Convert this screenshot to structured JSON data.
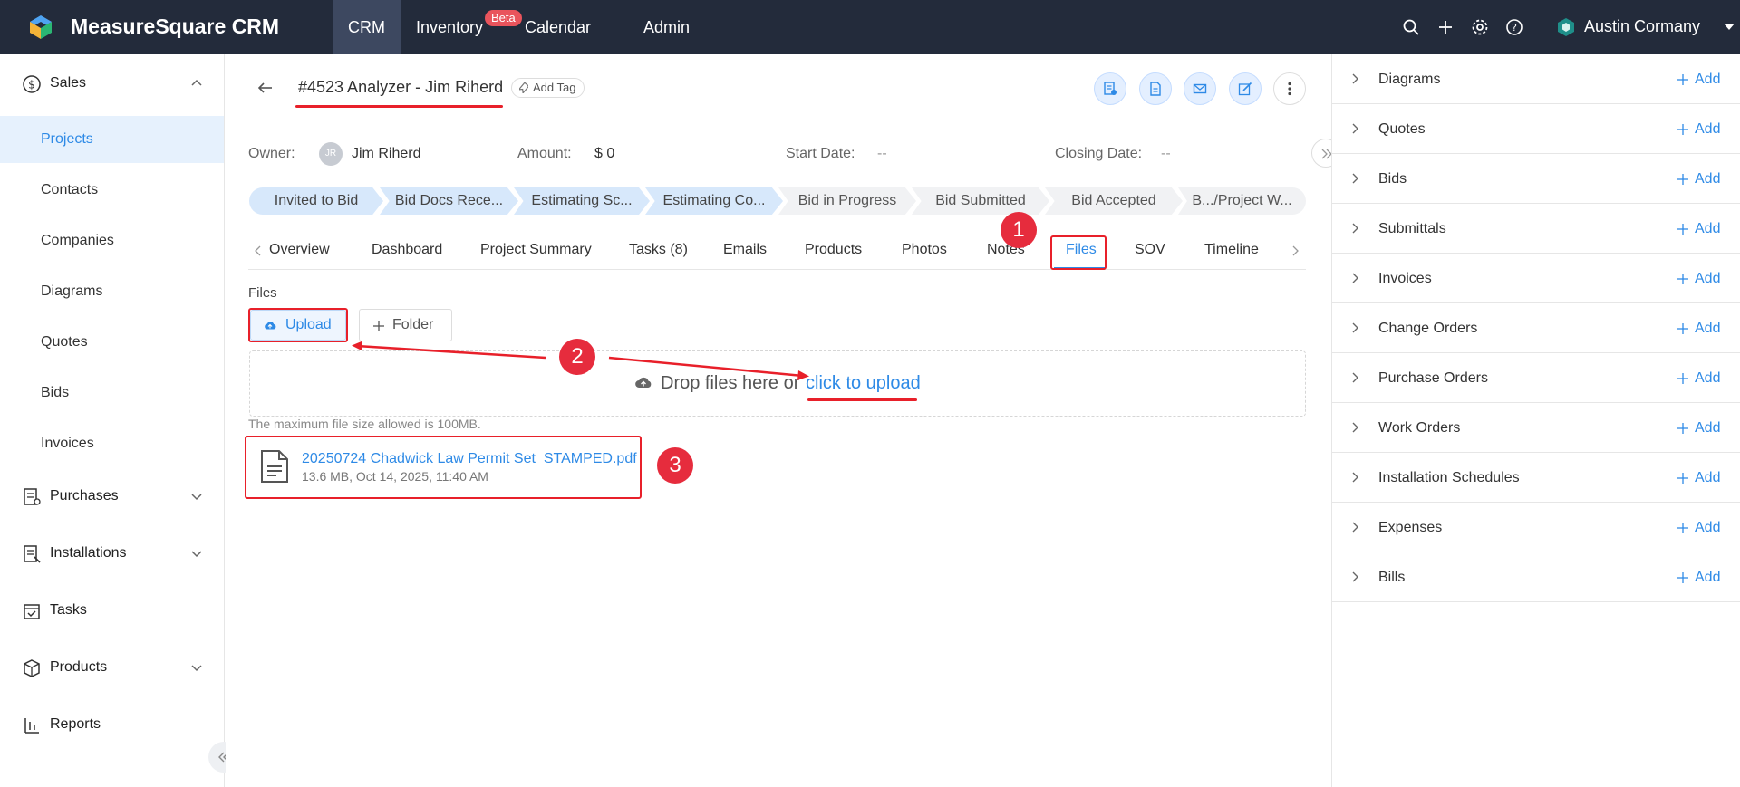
{
  "app": {
    "brand": "MeasureSquare CRM",
    "nav": [
      "CRM",
      "Inventory",
      "Calendar",
      "Admin"
    ],
    "beta_label": "Beta",
    "user_name": "Austin Cormany"
  },
  "sidebar": {
    "sales_label": "Sales",
    "items": [
      "Projects",
      "Contacts",
      "Companies",
      "Diagrams",
      "Quotes",
      "Bids",
      "Invoices"
    ],
    "purchases_label": "Purchases",
    "installations_label": "Installations",
    "tasks_label": "Tasks",
    "products_label": "Products",
    "reports_label": "Reports"
  },
  "project": {
    "title": "#4523 Analyzer - Jim Riherd",
    "add_tag": "Add Tag",
    "owner_label": "Owner:",
    "owner_initials": "JR",
    "owner_name": "Jim Riherd",
    "amount_label": "Amount:",
    "amount": "$ 0",
    "start_label": "Start Date:",
    "start_value": "--",
    "closing_label": "Closing Date:",
    "closing_value": "--"
  },
  "stages": [
    "Invited to Bid",
    "Bid Docs Rece...",
    "Estimating Sc...",
    "Estimating Co...",
    "Bid in Progress",
    "Bid Submitted",
    "Bid Accepted",
    "B.../Project W..."
  ],
  "tabs": [
    "Overview",
    "Dashboard",
    "Project Summary",
    "Tasks (8)",
    "Emails",
    "Products",
    "Photos",
    "Notes",
    "Files",
    "SOV",
    "Timeline"
  ],
  "active_tab": "Files",
  "files": {
    "section_label": "Files",
    "upload_label": "Upload",
    "folder_label": "Folder",
    "drop_text": "Drop files here or",
    "drop_link": "click to upload",
    "limit_text": "The maximum file size allowed is 100MB.",
    "file_name": "20250724 Chadwick Law Permit Set_STAMPED.pdf",
    "file_meta": "13.6 MB, Oct 14, 2025, 11:40 AM"
  },
  "annotations": [
    "1",
    "2",
    "3"
  ],
  "right_panel": {
    "add_label": "Add",
    "sections": [
      "Diagrams",
      "Quotes",
      "Bids",
      "Submittals",
      "Invoices",
      "Change Orders",
      "Purchase Orders",
      "Work Orders",
      "Installation Schedules",
      "Expenses",
      "Bills"
    ]
  },
  "colors": {
    "topbar": "#232b3b",
    "accent": "#2e8ae6",
    "annotation_red": "#e8202a",
    "stage_done": "#d7e8fb"
  }
}
